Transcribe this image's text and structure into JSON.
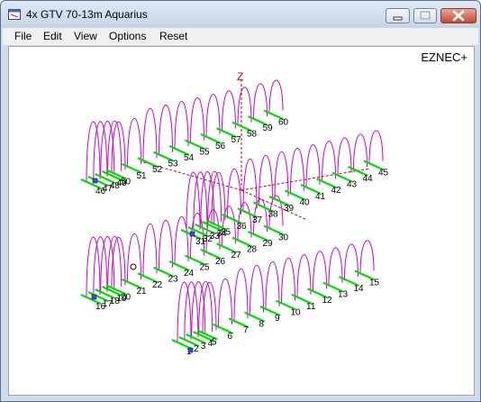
{
  "window": {
    "title": "4x GTV 70-13m Aquarius"
  },
  "menu": [
    "File",
    "Edit",
    "View",
    "Options",
    "Reset"
  ],
  "brand": "EZNEC+",
  "axis_label": "Z",
  "colors": {
    "pattern": "#cc00cc",
    "element": "#00dd00",
    "axis": "#cc0000",
    "title_bar": "#c5d5e8",
    "close_button": "#c24a35"
  },
  "title_buttons": [
    "minimize-icon",
    "maximize-icon",
    "close-icon"
  ],
  "segment_labels": [
    "1",
    "2",
    "3",
    "4",
    "5",
    "6",
    "7",
    "8",
    "9",
    "10",
    "11",
    "12",
    "13",
    "14",
    "15",
    "16",
    "17",
    "18",
    "19",
    "20",
    "21",
    "22",
    "23",
    "24",
    "25",
    "26",
    "27",
    "28",
    "29",
    "30",
    "31",
    "32",
    "33",
    "34",
    "35",
    "36",
    "37",
    "38",
    "39",
    "40",
    "41",
    "42",
    "43",
    "44",
    "45",
    "46",
    "47",
    "48",
    "49",
    "50",
    "51",
    "52",
    "53",
    "54",
    "55",
    "56",
    "57",
    "58",
    "59",
    "60"
  ]
}
